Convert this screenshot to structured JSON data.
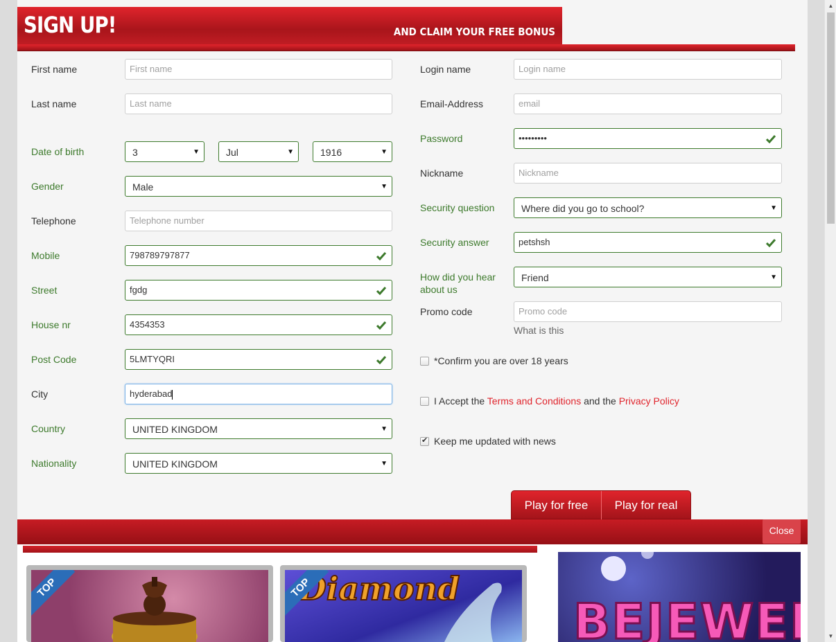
{
  "banner": {
    "title": "SIGN UP!",
    "subtitle": "AND CLAIM YOUR FREE BONUS"
  },
  "left_fields": {
    "first_name": {
      "label": "First name",
      "placeholder": "First name"
    },
    "last_name": {
      "label": "Last name",
      "placeholder": "Last name"
    },
    "dob": {
      "label": "Date of birth",
      "day": "3",
      "month": "Jul",
      "year": "1916"
    },
    "gender": {
      "label": "Gender",
      "value": "Male"
    },
    "telephone": {
      "label": "Telephone",
      "placeholder": "Telephone number"
    },
    "mobile": {
      "label": "Mobile",
      "value": "798789797877"
    },
    "street": {
      "label": "Street",
      "value": "fgdg"
    },
    "house_nr": {
      "label": "House nr",
      "value": "4354353"
    },
    "post_code": {
      "label": "Post Code",
      "value": "5LMTYQRI"
    },
    "city": {
      "label": "City",
      "value": "hyderabad"
    },
    "country": {
      "label": "Country",
      "value": "UNITED KINGDOM"
    },
    "nationality": {
      "label": "Nationality",
      "value": "UNITED KINGDOM"
    }
  },
  "right_fields": {
    "login_name": {
      "label": "Login name",
      "placeholder": "Login name"
    },
    "email": {
      "label": "Email-Address",
      "placeholder": "email"
    },
    "password": {
      "label": "Password",
      "value": "•••••••••"
    },
    "nickname": {
      "label": "Nickname",
      "placeholder": "Nickname"
    },
    "security_question": {
      "label": "Security question",
      "value": "Where did you go to school?"
    },
    "security_answer": {
      "label": "Security answer",
      "value": "petshsh"
    },
    "hear_about": {
      "label": "How did you hear about us",
      "value": "Friend"
    },
    "promo": {
      "label": "Promo code",
      "placeholder": "Promo code",
      "hint": "What is this"
    }
  },
  "checkboxes": {
    "age": {
      "text": "*Confirm you are over 18 years",
      "checked": false
    },
    "terms": {
      "text_before": "I Accept the ",
      "terms_link": "Terms and Conditions",
      "text_mid": " and the ",
      "privacy_link": "Privacy Policy",
      "checked": false
    },
    "news": {
      "text": "Keep me updated with news",
      "checked": true
    }
  },
  "buttons": {
    "play_free": "Play for free",
    "play_real": "Play for real",
    "close": "Close"
  },
  "background": {
    "tile1_badge": "TOP",
    "tile2_badge": "TOP",
    "tile2_title": "Diamond",
    "tile3_title": "BEJEWELED"
  },
  "colors": {
    "brand_red": "#c71c24",
    "valid_green": "#3d7a2c",
    "link_red": "#e0242c"
  }
}
